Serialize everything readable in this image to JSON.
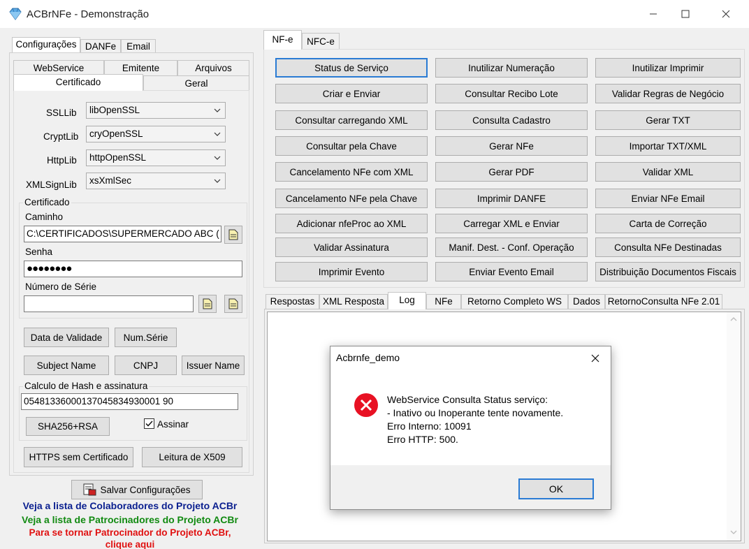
{
  "window": {
    "title": "ACBrNFe - Demonstração"
  },
  "left": {
    "tabs": [
      "Configurações",
      "DANFe",
      "Email"
    ],
    "subtabs_row1": [
      "WebService",
      "Emitente",
      "Arquivos"
    ],
    "subtabs_row2": [
      "Certificado",
      "Geral"
    ],
    "fields": {
      "ssllib_label": "SSLLib",
      "ssllib_value": "libOpenSSL",
      "cryptlib_label": "CryptLib",
      "cryptlib_value": "cryOpenSSL",
      "httplib_label": "HttpLib",
      "httplib_value": "httpOpenSSL",
      "xmlsignlib_label": "XMLSignLib",
      "xmlsignlib_value": "xsXmlSec"
    },
    "certificado": {
      "group_title": "Certificado",
      "caminho_label": "Caminho",
      "caminho_value": "C:\\CERTIFICADOS\\SUPERMERCADO ABC (",
      "senha_label": "Senha",
      "senha_value": "●●●●●●●●",
      "numero_serie_label": "Número de Série",
      "numero_serie_value": ""
    },
    "buttons": {
      "data_validade": "Data de Validade",
      "num_serie": "Num.Série",
      "subject_name": "Subject Name",
      "cnpj": "CNPJ",
      "issuer_name": "Issuer Name",
      "sha256": "SHA256+RSA",
      "https_sem_cert": "HTTPS sem Certificado",
      "leitura_x509": "Leitura de X509",
      "salvar": "Salvar Configurações"
    },
    "hash": {
      "group_title": "Calculo de Hash e assinatura",
      "value": "05481336000137045834930001 90",
      "assinar_label": "Assinar",
      "assinar_checked": true
    },
    "links": {
      "colaboradores": "Veja a lista de Colaboradores do Projeto ACBr",
      "patrocinadores": "Veja a lista de Patrocinadores do Projeto ACBr",
      "tornar": "Para se tornar Patrocinador do Projeto ACBr,",
      "clique": "clique aqui",
      "colaboradores_color": "#0a1f8f",
      "patrocinadores_color": "#118a11",
      "tornar_color": "#e01010"
    }
  },
  "right": {
    "tabs": [
      "NF-e",
      "NFC-e"
    ],
    "buttons": [
      [
        "Status de Serviço",
        "Inutilizar Numeração",
        "Inutilizar Imprimir"
      ],
      [
        "Criar e Enviar",
        "Consultar Recibo Lote",
        "Validar Regras de Negócio"
      ],
      [
        "Consultar carregando XML",
        "Consulta Cadastro",
        "Gerar TXT"
      ],
      [
        "Consultar pela Chave",
        "Gerar NFe",
        "Importar TXT/XML"
      ],
      [
        "Cancelamento NFe com XML",
        "Gerar PDF",
        "Validar XML"
      ],
      [
        "Cancelamento NFe pela Chave",
        "Imprimir DANFE",
        "Enviar NFe Email"
      ],
      [
        "Adicionar nfeProc ao XML",
        "Carregar XML e Enviar",
        "Carta de Correção"
      ],
      [
        "Validar Assinatura",
        "Manif. Dest. - Conf. Operação",
        "Consulta NFe Destinadas"
      ],
      [
        "Imprimir Evento",
        "Enviar Evento Email",
        "Distribuição Documentos Fiscais"
      ]
    ],
    "bottom_tabs": [
      "Respostas",
      "XML Resposta",
      "Log",
      "NFe",
      "Retorno Completo WS",
      "Dados",
      "RetornoConsulta NFe 2.01"
    ]
  },
  "dialog": {
    "title": "Acbrnfe_demo",
    "lines": [
      "WebService Consulta Status serviço:",
      "- Inativo ou Inoperante tente novamente.",
      "Erro Interno: 10091",
      "Erro HTTP: 500."
    ],
    "ok_label": "OK",
    "icon_color": "#e81123"
  }
}
